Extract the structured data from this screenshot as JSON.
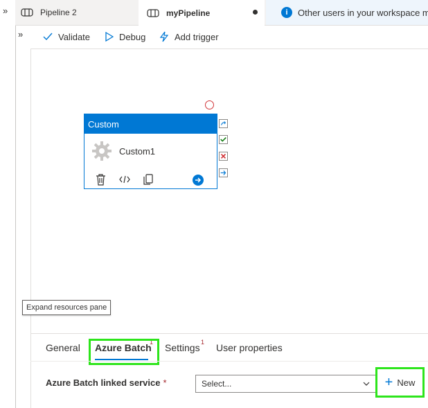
{
  "tabs": {
    "pipeline2": "Pipeline 2",
    "mypipeline": "myPipeline",
    "others": "Other users in your workspace m"
  },
  "toolbar": {
    "validate": "Validate",
    "debug": "Debug",
    "add_trigger": "Add trigger"
  },
  "activity": {
    "type": "Custom",
    "name": "Custom1"
  },
  "tooltip": "Expand resources pane",
  "panel": {
    "tabs": {
      "general": "General",
      "azure_batch": "Azure Batch",
      "azure_batch_badge": "1",
      "settings": "Settings",
      "settings_badge": "1",
      "user_properties": "User properties"
    },
    "linked_service_label": "Azure Batch linked service",
    "required_mark": "*",
    "select_placeholder": "Select...",
    "new_button": "New"
  },
  "colors": {
    "accent": "#0078d4",
    "highlight": "#2de51b",
    "error": "#d13438"
  }
}
